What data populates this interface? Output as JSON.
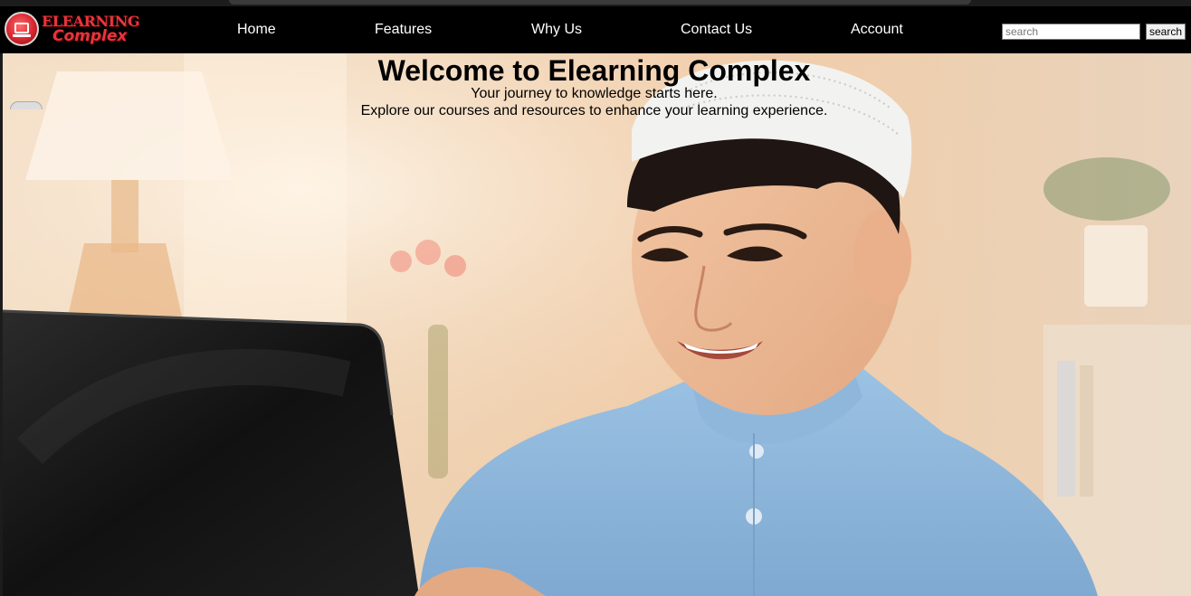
{
  "brand": {
    "line1": "ELEARNING",
    "line2": "Complex",
    "accent_color": "#e8343c"
  },
  "nav": {
    "items": [
      {
        "label": "Home"
      },
      {
        "label": "Features"
      },
      {
        "label": "Why Us"
      },
      {
        "label": "Contact Us"
      },
      {
        "label": "Account"
      }
    ]
  },
  "search": {
    "placeholder": "search",
    "value": "",
    "button_label": "search"
  },
  "hero": {
    "title": "Welcome to Elearning Complex",
    "subtitle": "Your journey to knowledge starts here.",
    "description": "Explore our courses and resources to enhance your learning experience.",
    "image_icon": "photo-boy-with-laptop"
  }
}
